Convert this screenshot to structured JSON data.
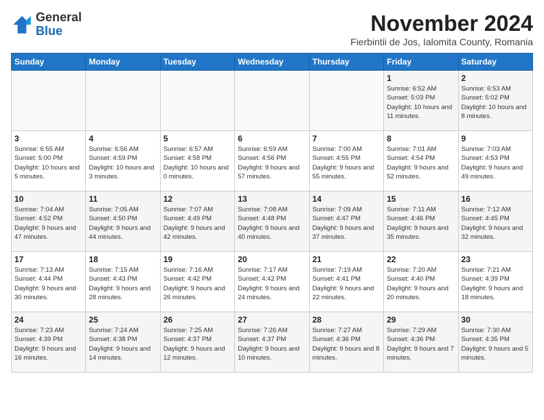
{
  "header": {
    "logo_general": "General",
    "logo_blue": "Blue",
    "title": "November 2024",
    "subtitle": "Fierbintii de Jos, Ialomita County, Romania"
  },
  "weekdays": [
    "Sunday",
    "Monday",
    "Tuesday",
    "Wednesday",
    "Thursday",
    "Friday",
    "Saturday"
  ],
  "weeks": [
    [
      {
        "day": "",
        "info": ""
      },
      {
        "day": "",
        "info": ""
      },
      {
        "day": "",
        "info": ""
      },
      {
        "day": "",
        "info": ""
      },
      {
        "day": "",
        "info": ""
      },
      {
        "day": "1",
        "info": "Sunrise: 6:52 AM\nSunset: 5:03 PM\nDaylight: 10 hours and 11 minutes."
      },
      {
        "day": "2",
        "info": "Sunrise: 6:53 AM\nSunset: 5:02 PM\nDaylight: 10 hours and 8 minutes."
      }
    ],
    [
      {
        "day": "3",
        "info": "Sunrise: 6:55 AM\nSunset: 5:00 PM\nDaylight: 10 hours and 5 minutes."
      },
      {
        "day": "4",
        "info": "Sunrise: 6:56 AM\nSunset: 4:59 PM\nDaylight: 10 hours and 3 minutes."
      },
      {
        "day": "5",
        "info": "Sunrise: 6:57 AM\nSunset: 4:58 PM\nDaylight: 10 hours and 0 minutes."
      },
      {
        "day": "6",
        "info": "Sunrise: 6:59 AM\nSunset: 4:56 PM\nDaylight: 9 hours and 57 minutes."
      },
      {
        "day": "7",
        "info": "Sunrise: 7:00 AM\nSunset: 4:55 PM\nDaylight: 9 hours and 55 minutes."
      },
      {
        "day": "8",
        "info": "Sunrise: 7:01 AM\nSunset: 4:54 PM\nDaylight: 9 hours and 52 minutes."
      },
      {
        "day": "9",
        "info": "Sunrise: 7:03 AM\nSunset: 4:53 PM\nDaylight: 9 hours and 49 minutes."
      }
    ],
    [
      {
        "day": "10",
        "info": "Sunrise: 7:04 AM\nSunset: 4:52 PM\nDaylight: 9 hours and 47 minutes."
      },
      {
        "day": "11",
        "info": "Sunrise: 7:05 AM\nSunset: 4:50 PM\nDaylight: 9 hours and 44 minutes."
      },
      {
        "day": "12",
        "info": "Sunrise: 7:07 AM\nSunset: 4:49 PM\nDaylight: 9 hours and 42 minutes."
      },
      {
        "day": "13",
        "info": "Sunrise: 7:08 AM\nSunset: 4:48 PM\nDaylight: 9 hours and 40 minutes."
      },
      {
        "day": "14",
        "info": "Sunrise: 7:09 AM\nSunset: 4:47 PM\nDaylight: 9 hours and 37 minutes."
      },
      {
        "day": "15",
        "info": "Sunrise: 7:11 AM\nSunset: 4:46 PM\nDaylight: 9 hours and 35 minutes."
      },
      {
        "day": "16",
        "info": "Sunrise: 7:12 AM\nSunset: 4:45 PM\nDaylight: 9 hours and 32 minutes."
      }
    ],
    [
      {
        "day": "17",
        "info": "Sunrise: 7:13 AM\nSunset: 4:44 PM\nDaylight: 9 hours and 30 minutes."
      },
      {
        "day": "18",
        "info": "Sunrise: 7:15 AM\nSunset: 4:43 PM\nDaylight: 9 hours and 28 minutes."
      },
      {
        "day": "19",
        "info": "Sunrise: 7:16 AM\nSunset: 4:42 PM\nDaylight: 9 hours and 26 minutes."
      },
      {
        "day": "20",
        "info": "Sunrise: 7:17 AM\nSunset: 4:42 PM\nDaylight: 9 hours and 24 minutes."
      },
      {
        "day": "21",
        "info": "Sunrise: 7:19 AM\nSunset: 4:41 PM\nDaylight: 9 hours and 22 minutes."
      },
      {
        "day": "22",
        "info": "Sunrise: 7:20 AM\nSunset: 4:40 PM\nDaylight: 9 hours and 20 minutes."
      },
      {
        "day": "23",
        "info": "Sunrise: 7:21 AM\nSunset: 4:39 PM\nDaylight: 9 hours and 18 minutes."
      }
    ],
    [
      {
        "day": "24",
        "info": "Sunrise: 7:23 AM\nSunset: 4:39 PM\nDaylight: 9 hours and 16 minutes."
      },
      {
        "day": "25",
        "info": "Sunrise: 7:24 AM\nSunset: 4:38 PM\nDaylight: 9 hours and 14 minutes."
      },
      {
        "day": "26",
        "info": "Sunrise: 7:25 AM\nSunset: 4:37 PM\nDaylight: 9 hours and 12 minutes."
      },
      {
        "day": "27",
        "info": "Sunrise: 7:26 AM\nSunset: 4:37 PM\nDaylight: 9 hours and 10 minutes."
      },
      {
        "day": "28",
        "info": "Sunrise: 7:27 AM\nSunset: 4:36 PM\nDaylight: 9 hours and 8 minutes."
      },
      {
        "day": "29",
        "info": "Sunrise: 7:29 AM\nSunset: 4:36 PM\nDaylight: 9 hours and 7 minutes."
      },
      {
        "day": "30",
        "info": "Sunrise: 7:30 AM\nSunset: 4:35 PM\nDaylight: 9 hours and 5 minutes."
      }
    ]
  ]
}
